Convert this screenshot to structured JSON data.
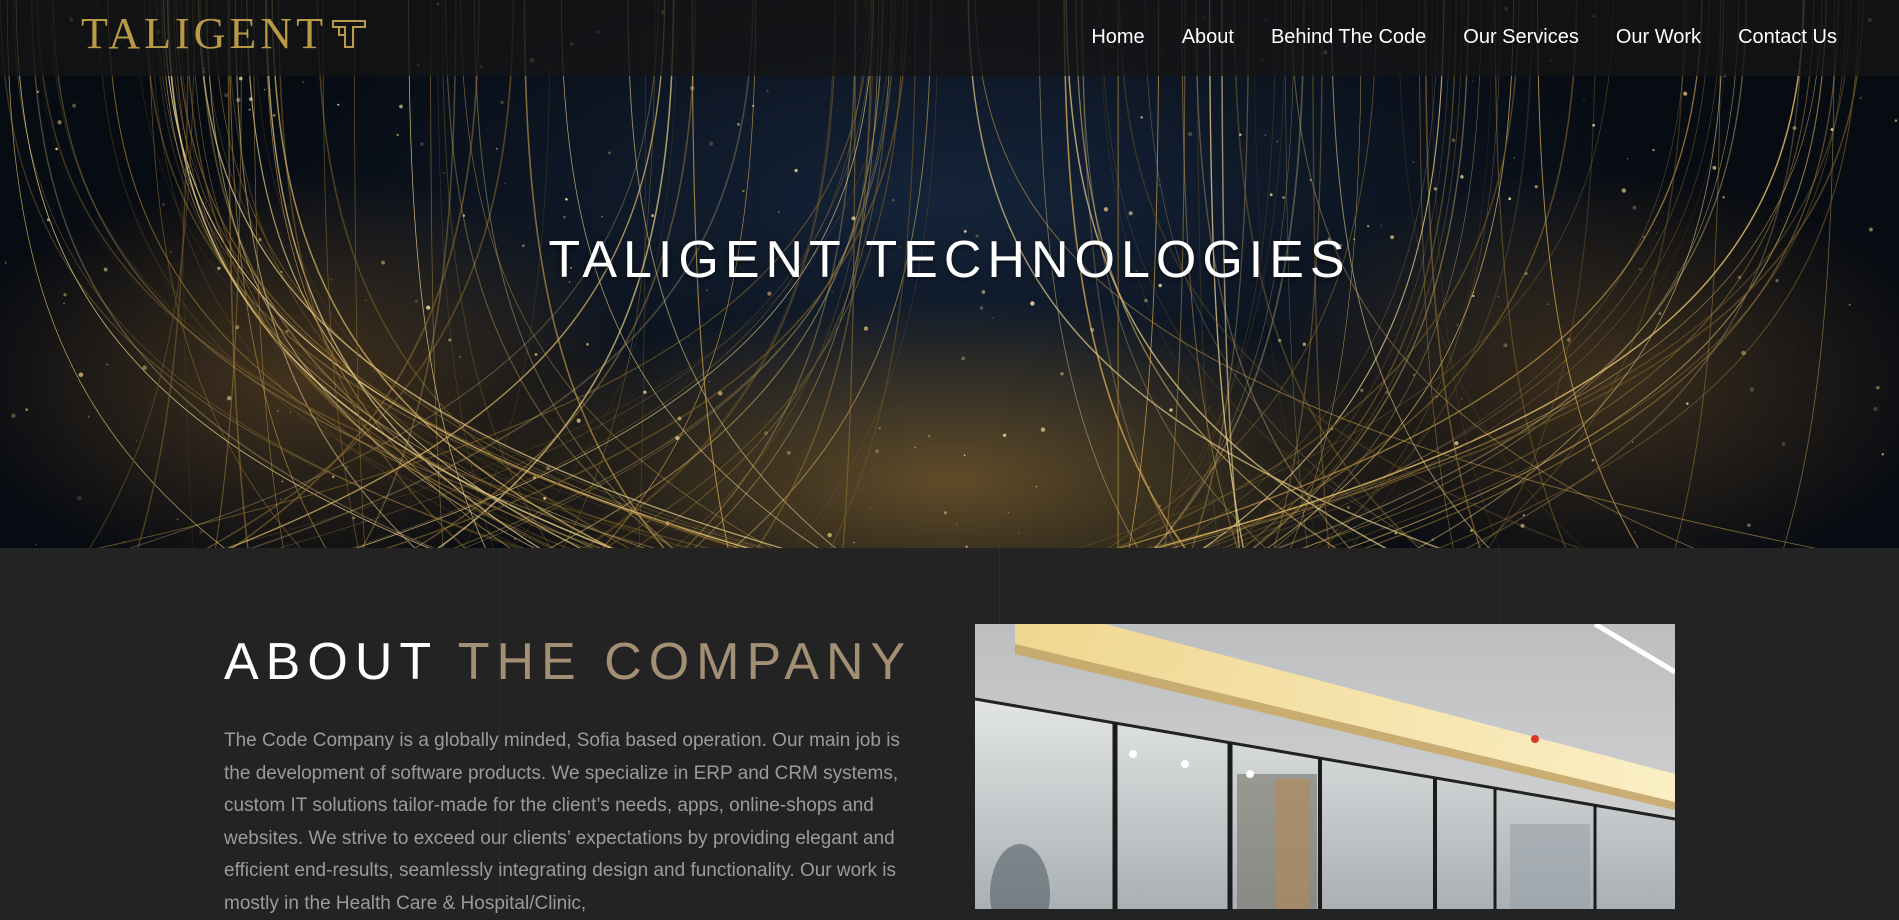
{
  "navbar": {
    "logo_text": "TALIGENT",
    "items": [
      {
        "label": "Home"
      },
      {
        "label": "About"
      },
      {
        "label": "Behind The Code"
      },
      {
        "label": "Our Services"
      },
      {
        "label": "Our Work"
      },
      {
        "label": "Contact Us"
      }
    ]
  },
  "hero": {
    "title": "TALIGENT TECHNOLOGIES"
  },
  "about": {
    "heading_part1": "ABOUT",
    "heading_part2": "THE COMPANY",
    "body": "The Code Company is a globally minded, Sofia based operation. Our main job is the development of software products. We specialize in ERP and CRM systems, custom IT solutions tailor-made for the client’s needs, apps, online-shops and websites. We strive to exceed our clients’ expectations by providing elegant and efficient end-results, seamlessly integrating design and functionality. Our work is mostly in the Health Care & Hospital/Clinic,"
  },
  "colors": {
    "accent_gold": "#b99a47",
    "heading_tan": "#a38f73",
    "background": "#232323",
    "body_text": "#9b9b9b"
  }
}
